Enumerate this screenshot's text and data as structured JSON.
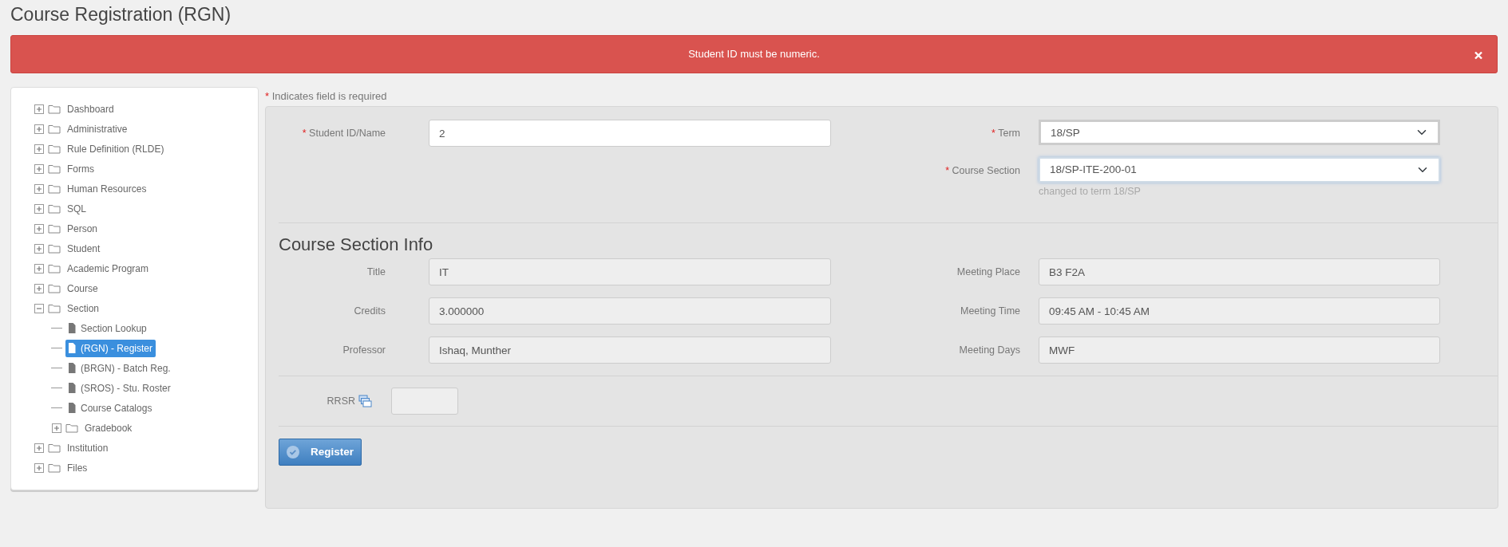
{
  "page_title": "Course Registration (RGN)",
  "alert": {
    "message": "Student ID must be numeric.",
    "dismissible": true
  },
  "sidebar": {
    "items": [
      {
        "label": "Dashboard",
        "kind": "folder",
        "expanded": false,
        "selected": false
      },
      {
        "label": "Administrative",
        "kind": "folder",
        "expanded": false,
        "selected": false
      },
      {
        "label": "Rule Definition (RLDE)",
        "kind": "folder",
        "expanded": false,
        "selected": false
      },
      {
        "label": "Forms",
        "kind": "folder",
        "expanded": false,
        "selected": false
      },
      {
        "label": "Human Resources",
        "kind": "folder",
        "expanded": false,
        "selected": false
      },
      {
        "label": "SQL",
        "kind": "folder",
        "expanded": false,
        "selected": false
      },
      {
        "label": "Person",
        "kind": "folder",
        "expanded": false,
        "selected": false
      },
      {
        "label": "Student",
        "kind": "folder",
        "expanded": false,
        "selected": false
      },
      {
        "label": "Academic Program",
        "kind": "folder",
        "expanded": false,
        "selected": false
      },
      {
        "label": "Course",
        "kind": "folder",
        "expanded": false,
        "selected": false
      },
      {
        "label": "Section",
        "kind": "folder",
        "expanded": true,
        "selected": false,
        "children": [
          {
            "label": "Section Lookup",
            "kind": "page",
            "selected": false
          },
          {
            "label": "(RGN) - Register",
            "kind": "page",
            "selected": true
          },
          {
            "label": "(BRGN) - Batch Reg.",
            "kind": "page",
            "selected": false
          },
          {
            "label": "(SROS) - Stu. Roster",
            "kind": "page",
            "selected": false
          },
          {
            "label": "Course Catalogs",
            "kind": "page",
            "selected": false
          },
          {
            "label": "Gradebook",
            "kind": "folder",
            "expanded": false,
            "selected": false
          }
        ]
      },
      {
        "label": "Institution",
        "kind": "folder",
        "expanded": false,
        "selected": false
      },
      {
        "label": "Files",
        "kind": "folder",
        "expanded": false,
        "selected": false
      }
    ]
  },
  "required_note": {
    "mark": "*",
    "text": "Indicates field is required"
  },
  "form": {
    "student": {
      "label": "Student ID/Name",
      "required": true,
      "value": "2"
    },
    "term": {
      "label": "Term",
      "required": true,
      "value": "18/SP",
      "focused": false
    },
    "course_section": {
      "label": "Course Section",
      "required": true,
      "value": "18/SP-ITE-200-01",
      "focused": true,
      "help": "changed to term 18/SP"
    }
  },
  "section_info": {
    "heading": "Course Section Info",
    "rows": [
      [
        {
          "label": "Title",
          "value": "IT"
        },
        {
          "label": "Meeting Place",
          "value": "B3 F2A"
        }
      ],
      [
        {
          "label": "Credits",
          "value": "3.000000"
        },
        {
          "label": "Meeting Time",
          "value": "09:45 AM - 10:45 AM"
        }
      ],
      [
        {
          "label": "Professor",
          "value": "Ishaq, Munther"
        },
        {
          "label": "Meeting Days",
          "value": "MWF"
        }
      ]
    ]
  },
  "rrsr": {
    "label": "RRSR"
  },
  "register_button": "Register"
}
